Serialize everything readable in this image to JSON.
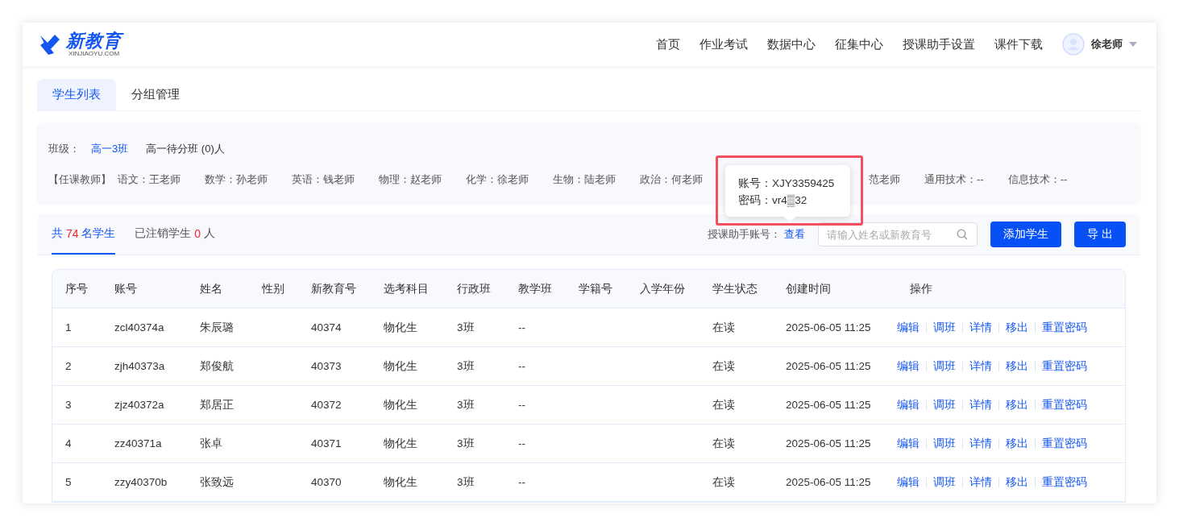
{
  "header": {
    "logo": "新教育",
    "logo_sub": "XINJIAOYU.COM",
    "nav": [
      {
        "label": "首页"
      },
      {
        "label": "作业考试"
      },
      {
        "label": "数据中心"
      },
      {
        "label": "征集中心"
      },
      {
        "label": "授课助手设置"
      },
      {
        "label": "课件下载"
      }
    ],
    "user": "徐老师"
  },
  "tabs": [
    {
      "label": "学生列表",
      "selected": true
    },
    {
      "label": "分组管理",
      "selected": false
    }
  ],
  "class_info": {
    "label": "班级：",
    "class_name": "高一3班",
    "pending": "高一待分班 (0)人"
  },
  "teachers": {
    "label": "【任课教师】",
    "items": [
      {
        "text": "语文：王老师",
        "kind": "full"
      },
      {
        "text": "数学：孙老师",
        "kind": "full"
      },
      {
        "text": "英语：钱老师",
        "kind": "full"
      },
      {
        "text": "物理：赵老师",
        "kind": "full"
      },
      {
        "text": "化学：徐老师",
        "kind": "full"
      },
      {
        "text": "生物：陆老师",
        "kind": "full"
      },
      {
        "text": "政治：何老师",
        "kind": "full"
      },
      {
        "text": "范老师",
        "kind": "covered"
      },
      {
        "text": "通用技术：--",
        "kind": "full"
      },
      {
        "text": "信息技术：--",
        "kind": "full"
      }
    ]
  },
  "tooltip": {
    "lines": [
      "账号：XJY3359425",
      "密码：vr4▒32"
    ]
  },
  "toolbar": {
    "tabs": [
      {
        "parts": [
          "共 ",
          "74",
          " 名学生"
        ],
        "selected": true
      },
      {
        "parts": [
          "已注销学生 ",
          "0",
          " 人"
        ],
        "selected": false
      }
    ],
    "assistant_label": "授课助手账号：",
    "view_link": "查看",
    "search": {
      "placeholder": "请输入姓名或新教育号"
    },
    "buttons": [
      "添加学生",
      "导 出"
    ]
  },
  "table": {
    "columns": [
      "序号",
      "账号",
      "姓名",
      "性别",
      "新教育号",
      "选考科目",
      "行政班",
      "教学班",
      "学籍号",
      "入学年份",
      "学生状态",
      "创建时间",
      "操作"
    ],
    "rows": [
      {
        "cells": [
          "1",
          "zcl40374a",
          "朱辰璐",
          "",
          "40374",
          "物化生",
          "3班",
          "--",
          "",
          "",
          "在读",
          "2025-06-05 11:25"
        ],
        "actions": [
          "编辑",
          "调班",
          "详情",
          "移出",
          "重置密码"
        ]
      },
      {
        "cells": [
          "2",
          "zjh40373a",
          "郑俊航",
          "",
          "40373",
          "物化生",
          "3班",
          "--",
          "",
          "",
          "在读",
          "2025-06-05 11:25"
        ],
        "actions": [
          "编辑",
          "调班",
          "详情",
          "移出",
          "重置密码"
        ]
      },
      {
        "cells": [
          "3",
          "zjz40372a",
          "郑居正",
          "",
          "40372",
          "物化生",
          "3班",
          "--",
          "",
          "",
          "在读",
          "2025-06-05 11:25"
        ],
        "actions": [
          "编辑",
          "调班",
          "详情",
          "移出",
          "重置密码"
        ]
      },
      {
        "cells": [
          "4",
          "zz40371a",
          "张卓",
          "",
          "40371",
          "物化生",
          "3班",
          "--",
          "",
          "",
          "在读",
          "2025-06-05 11:25"
        ],
        "actions": [
          "编辑",
          "调班",
          "详情",
          "移出",
          "重置密码"
        ]
      },
      {
        "cells": [
          "5",
          "zzy40370b",
          "张致远",
          "",
          "40370",
          "物化生",
          "3班",
          "--",
          "",
          "",
          "在读",
          "2025-06-05 11:25"
        ],
        "actions": [
          "编辑",
          "调班",
          "详情",
          "移出",
          "重置密码"
        ]
      }
    ]
  }
}
